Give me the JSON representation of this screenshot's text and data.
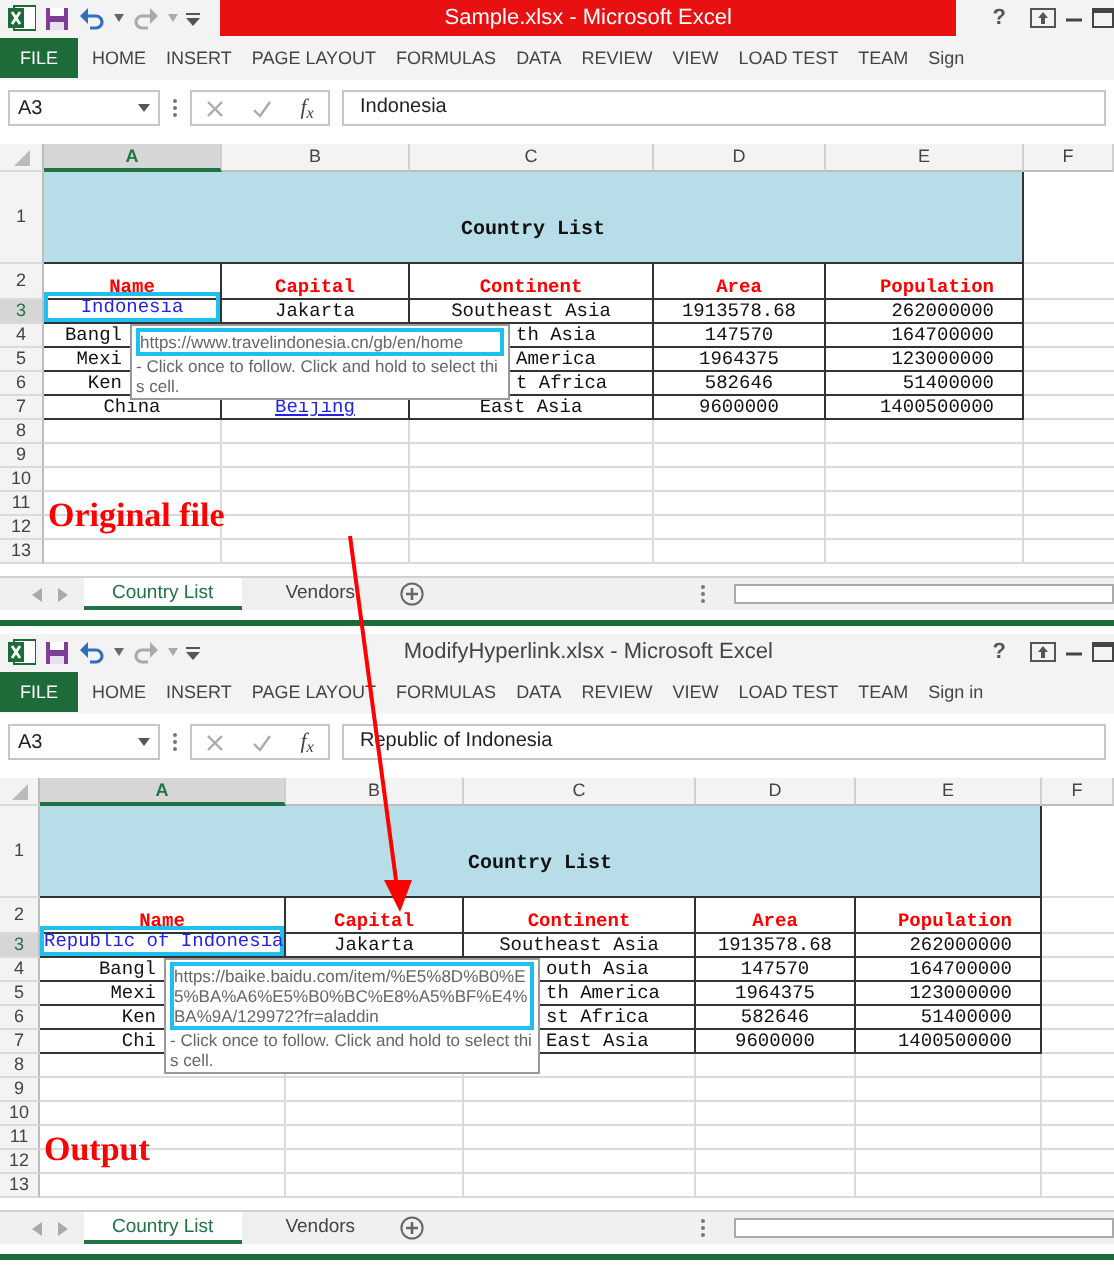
{
  "windows": [
    {
      "title": "Sample.xlsx -  Microsoft Excel",
      "title_highlighted": true,
      "help": "?",
      "ribbon_tabs": [
        {
          "label": "FILE",
          "kind": "file"
        },
        {
          "label": "HOME",
          "kind": "tab"
        },
        {
          "label": "INSERT",
          "kind": "tab"
        },
        {
          "label": "PAGE LAYOUT",
          "kind": "tab"
        },
        {
          "label": "FORMULAS",
          "kind": "tab"
        },
        {
          "label": "DATA",
          "kind": "tab"
        },
        {
          "label": "REVIEW",
          "kind": "tab"
        },
        {
          "label": "VIEW",
          "kind": "tab"
        },
        {
          "label": "LOAD TEST",
          "kind": "tab"
        },
        {
          "label": "TEAM",
          "kind": "tab"
        },
        {
          "label": "Sign",
          "kind": "tab"
        }
      ],
      "name_box": "A3",
      "function_label": "f$_{x}$",
      "formula_value": "Indonesia",
      "column_headers": [
        {
          "label": "A",
          "selected": true
        },
        {
          "label": "B",
          "selected": false
        },
        {
          "label": "C",
          "selected": false
        },
        {
          "label": "D",
          "selected": false
        },
        {
          "label": "E",
          "selected": false
        },
        {
          "label": "F",
          "selected": false
        }
      ],
      "rows": [
        {
          "number": "1",
          "selected": false,
          "cells": [
            {
              "text": "Country List",
              "kind": "title"
            }
          ]
        },
        {
          "number": "2",
          "selected": false,
          "cells": [
            {
              "text": "Name",
              "kind": "header"
            },
            {
              "text": "Capital",
              "kind": "header"
            },
            {
              "text": "Continent",
              "kind": "header"
            },
            {
              "text": "Area",
              "kind": "header"
            },
            {
              "text": "Population",
              "kind": "header"
            }
          ]
        },
        {
          "number": "3",
          "selected": true,
          "cells": [
            {
              "text": "Indonesia",
              "kind": "link",
              "selected": true
            },
            {
              "text": "Jakarta",
              "kind": "text"
            },
            {
              "text": "Southeast Asia",
              "kind": "text"
            },
            {
              "text": "1913578.68",
              "kind": "text"
            },
            {
              "text": "262000000",
              "kind": "text"
            }
          ]
        },
        {
          "number": "4",
          "selected": false,
          "cells": [
            {
              "text": "Bangl",
              "kind": "text"
            },
            null,
            {
              "text": "th Asia",
              "kind": "text"
            },
            {
              "text": "147570",
              "kind": "text"
            },
            {
              "text": "164700000",
              "kind": "text"
            }
          ]
        },
        {
          "number": "5",
          "selected": false,
          "cells": [
            {
              "text": "Mexi",
              "kind": "text"
            },
            null,
            {
              "text": "America",
              "kind": "text"
            },
            {
              "text": "1964375",
              "kind": "text"
            },
            {
              "text": "123000000",
              "kind": "text"
            }
          ]
        },
        {
          "number": "6",
          "selected": false,
          "cells": [
            {
              "text": "Ken",
              "kind": "text"
            },
            null,
            {
              "text": "t Africa",
              "kind": "text"
            },
            {
              "text": "582646",
              "kind": "text"
            },
            {
              "text": "51400000",
              "kind": "text"
            }
          ]
        },
        {
          "number": "7",
          "selected": false,
          "cells": [
            {
              "text": "China",
              "kind": "text"
            },
            {
              "text": "Beijing",
              "kind": "link-underlined"
            },
            {
              "text": "East Asia",
              "kind": "text"
            },
            {
              "text": "9600000",
              "kind": "text"
            },
            {
              "text": "1400500000",
              "kind": "text"
            }
          ]
        },
        {
          "number": "8",
          "selected": false
        },
        {
          "number": "9",
          "selected": false
        },
        {
          "number": "10",
          "selected": false
        },
        {
          "number": "11",
          "selected": false
        },
        {
          "number": "12",
          "selected": false
        },
        {
          "number": "13",
          "selected": false
        }
      ],
      "tooltip": {
        "url": "https://www.travelindonesia.cn/gb/en/home",
        "hint": "- Click once to follow. Click and hold to select this cell."
      },
      "annotation": "Original file",
      "sheet_tabs": [
        {
          "label": "Country List",
          "selected": true
        },
        {
          "label": "Vendors",
          "selected": false
        }
      ]
    },
    {
      "title": "ModifyHyperlink.xlsx - Microsoft Excel",
      "title_highlighted": false,
      "help": "?",
      "ribbon_tabs": [
        {
          "label": "FILE",
          "kind": "file"
        },
        {
          "label": "HOME",
          "kind": "tab"
        },
        {
          "label": "INSERT",
          "kind": "tab"
        },
        {
          "label": "PAGE LAYOUT",
          "kind": "tab"
        },
        {
          "label": "FORMULAS",
          "kind": "tab"
        },
        {
          "label": "DATA",
          "kind": "tab"
        },
        {
          "label": "REVIEW",
          "kind": "tab"
        },
        {
          "label": "VIEW",
          "kind": "tab"
        },
        {
          "label": "LOAD TEST",
          "kind": "tab"
        },
        {
          "label": "TEAM",
          "kind": "tab"
        },
        {
          "label": "Sign in",
          "kind": "tab"
        }
      ],
      "name_box": "A3",
      "function_label": "f$_{x}$",
      "formula_value": "Republic of Indonesia",
      "column_headers": [
        {
          "label": "A",
          "selected": true
        },
        {
          "label": "B",
          "selected": false
        },
        {
          "label": "C",
          "selected": false
        },
        {
          "label": "D",
          "selected": false
        },
        {
          "label": "E",
          "selected": false
        },
        {
          "label": "F",
          "selected": false
        }
      ],
      "rows": [
        {
          "number": "1",
          "selected": false,
          "cells": [
            {
              "text": "Country List",
              "kind": "title"
            }
          ]
        },
        {
          "number": "2",
          "selected": false,
          "cells": [
            {
              "text": "Name",
              "kind": "header"
            },
            {
              "text": "Capital",
              "kind": "header"
            },
            {
              "text": "Continent",
              "kind": "header"
            },
            {
              "text": "Area",
              "kind": "header"
            },
            {
              "text": "Population",
              "kind": "header"
            }
          ]
        },
        {
          "number": "3",
          "selected": true,
          "cells": [
            {
              "text": "Republic of Indonesia",
              "kind": "link",
              "selected": true
            },
            {
              "text": "Jakarta",
              "kind": "text"
            },
            {
              "text": "Southeast Asia",
              "kind": "text"
            },
            {
              "text": "1913578.68",
              "kind": "text"
            },
            {
              "text": "262000000",
              "kind": "text"
            }
          ]
        },
        {
          "number": "4",
          "selected": false,
          "cells": [
            {
              "text": "Bangl",
              "kind": "text"
            },
            null,
            {
              "text": "outh Asia",
              "kind": "text"
            },
            {
              "text": "147570",
              "kind": "text"
            },
            {
              "text": "164700000",
              "kind": "text"
            }
          ]
        },
        {
          "number": "5",
          "selected": false,
          "cells": [
            {
              "text": "Mexi",
              "kind": "text"
            },
            null,
            {
              "text": "th America",
              "kind": "text"
            },
            {
              "text": "1964375",
              "kind": "text"
            },
            {
              "text": "123000000",
              "kind": "text"
            }
          ]
        },
        {
          "number": "6",
          "selected": false,
          "cells": [
            {
              "text": "Ken",
              "kind": "text"
            },
            null,
            {
              "text": "st Africa",
              "kind": "text"
            },
            {
              "text": "582646",
              "kind": "text"
            },
            {
              "text": "51400000",
              "kind": "text"
            }
          ]
        },
        {
          "number": "7",
          "selected": false,
          "cells": [
            {
              "text": "Chi",
              "kind": "text"
            },
            null,
            {
              "text": "East Asia",
              "kind": "text"
            },
            {
              "text": "9600000",
              "kind": "text"
            },
            {
              "text": "1400500000",
              "kind": "text"
            }
          ]
        },
        {
          "number": "8",
          "selected": false
        },
        {
          "number": "9",
          "selected": false
        },
        {
          "number": "10",
          "selected": false
        },
        {
          "number": "11",
          "selected": false
        },
        {
          "number": "12",
          "selected": false
        },
        {
          "number": "13",
          "selected": false
        }
      ],
      "tooltip": {
        "url": "https://baike.baidu.com/item/%E5%8D%B0%E5%BA%A6%E5%B0%BC%E8%A5%BF%E4%BA%9A/129972?fr=aladdin",
        "hint": "- Click once to follow. Click and hold to select this cell."
      },
      "annotation": "Output",
      "sheet_tabs": [
        {
          "label": "Country List",
          "selected": true
        },
        {
          "label": "Vendors",
          "selected": false
        }
      ]
    }
  ]
}
